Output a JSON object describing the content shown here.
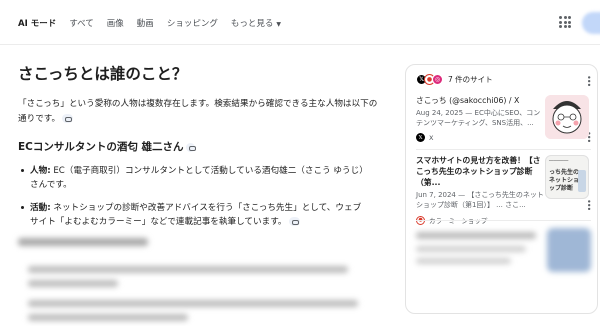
{
  "nav": {
    "tabs": [
      "AI モード",
      "すべて",
      "画像",
      "動画",
      "ショッピング",
      "もっと見る"
    ]
  },
  "answer": {
    "question": "さこっちとは誰のこと？",
    "intro": "「さこっち」という愛称の人物は複数存在します。検索結果から確認できる主な人物は以下の通りです。",
    "section_heading": "ECコンサルタントの酒匂 雄二さん",
    "bullets": [
      {
        "label": "人物:",
        "text": " EC（電子商取引）コンサルタントとして活動している酒匂雄二（さこう ゆうじ）さんです。"
      },
      {
        "label": "活動:",
        "text": " ネットショップの診断や改善アドバイスを行う「さこっち先生」として、ウェブサイト「よむよむカラーミー」などで連載記事を執筆しています。"
      }
    ]
  },
  "sources": {
    "title": "7 件のサイト",
    "items": [
      {
        "title": "さこっち (@sakocchi06) / X",
        "snippet": "Aug 24, 2025 — EC中心にSEO、コンテンツマーケティング、SNS活用、...",
        "site": "X",
        "icon": "x-logo-icon"
      },
      {
        "title": "スマホサイトの見せ方を改善！【さこっち先生のネットショップ診断（第...",
        "snippet": "Jun 7, 2024 — 【さこっち先生のネットショップ診断（第1回）】 ... さこ...",
        "site": "カラーミーショップ",
        "icon": "colorme-logo-icon",
        "thumb_text": "っち先生のネットショップ診断"
      }
    ]
  },
  "colors": {
    "accent": "#1a73e8",
    "x_brand": "#000000",
    "colorme_brand": "#d93a2b"
  }
}
